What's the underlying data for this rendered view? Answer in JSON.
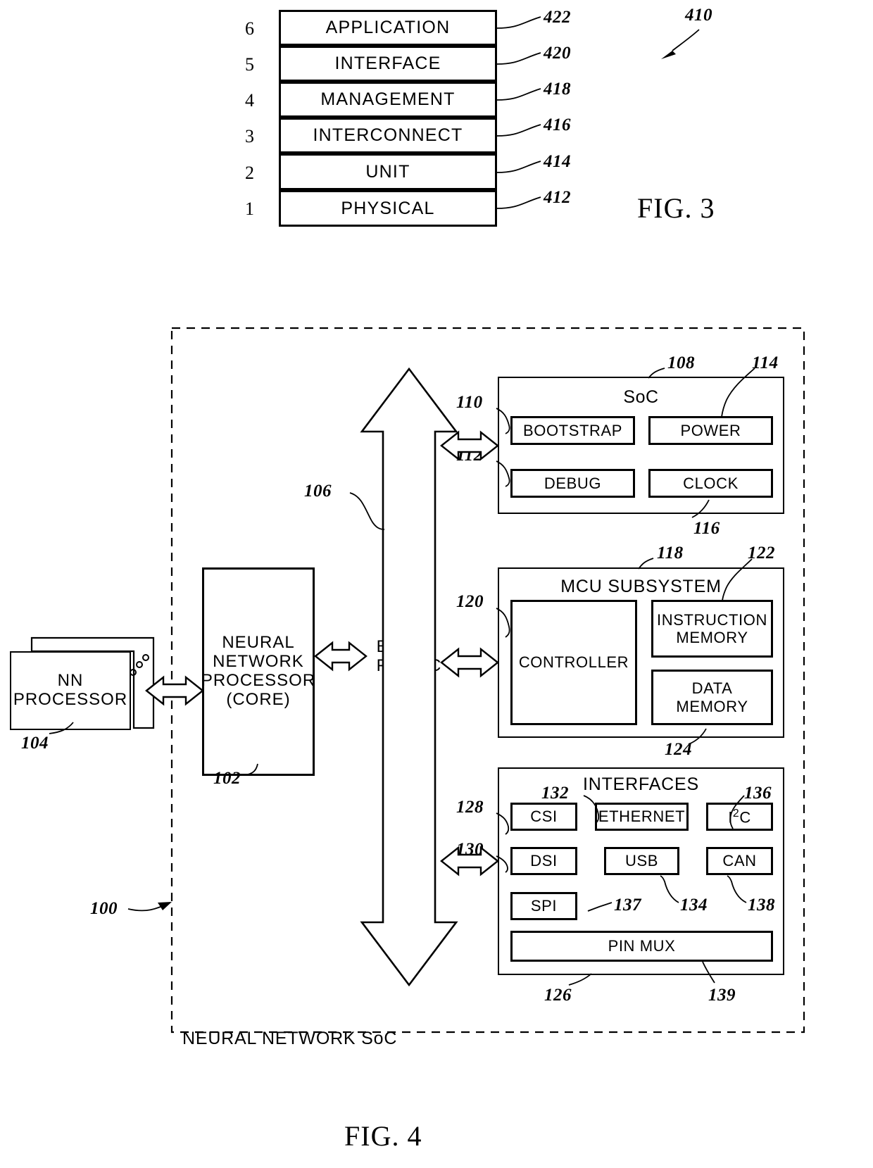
{
  "figure3": {
    "caption": "FIG. 3",
    "stack_ref": "410",
    "levels": [
      {
        "num": "6",
        "name": "APPLICATION",
        "ref": "422"
      },
      {
        "num": "5",
        "name": "INTERFACE",
        "ref": "420"
      },
      {
        "num": "4",
        "name": "MANAGEMENT",
        "ref": "418"
      },
      {
        "num": "3",
        "name": "INTERCONNECT",
        "ref": "416"
      },
      {
        "num": "2",
        "name": "UNIT",
        "ref": "414"
      },
      {
        "num": "1",
        "name": "PHYSICAL",
        "ref": "412"
      }
    ]
  },
  "figure4": {
    "caption": "FIG. 4",
    "outer_label": "NEURAL  NETWORK  SoC",
    "outer_ref": "100",
    "nn_processor": {
      "label": "NN\nPROCESSOR",
      "ref": "104"
    },
    "core": {
      "label": "NEURAL\nNETWORK\nPROCESSOR\n(CORE)",
      "ref": "102"
    },
    "bus": {
      "label": "BUS\nFABRIC",
      "ref": "106"
    },
    "soc": {
      "title": "SoC",
      "ref": "108",
      "blocks": [
        {
          "label": "BOOTSTRAP",
          "ref": "110"
        },
        {
          "label": "POWER",
          "ref": "114"
        },
        {
          "label": "DEBUG",
          "ref": "112"
        },
        {
          "label": "CLOCK",
          "ref": "116"
        }
      ]
    },
    "mcu": {
      "title": "MCU  SUBSYSTEM",
      "ref": "118",
      "blocks": [
        {
          "label": "CONTROLLER",
          "ref": "120"
        },
        {
          "label": "INSTRUCTION\nMEMORY",
          "ref": "122"
        },
        {
          "label": "DATA\nMEMORY",
          "ref": "124"
        }
      ]
    },
    "interfaces": {
      "title": "INTERFACES",
      "ref": "126",
      "blocks": [
        {
          "label": "CSI",
          "ref": "128"
        },
        {
          "label": "ETHERNET",
          "ref": "132"
        },
        {
          "label": "I2C",
          "ref": "136"
        },
        {
          "label": "DSI",
          "ref": "130"
        },
        {
          "label": "USB",
          "ref": "134"
        },
        {
          "label": "CAN",
          "ref": "138"
        },
        {
          "label": "SPI",
          "ref": "137"
        },
        {
          "label": "PIN  MUX",
          "ref": "139"
        }
      ]
    }
  }
}
